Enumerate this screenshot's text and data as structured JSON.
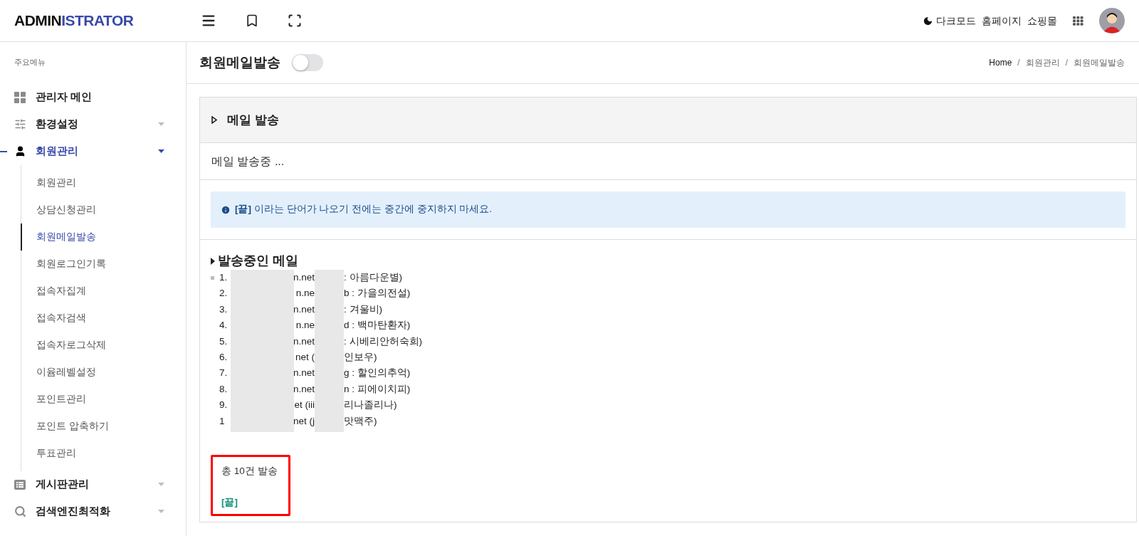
{
  "header": {
    "logo": {
      "part_1": "ADMIN",
      "part_2": "ISTRATOR"
    },
    "links": [
      {
        "kind": "darkmode",
        "label": "다크모드"
      },
      {
        "kind": "link",
        "label": "홈페이지"
      },
      {
        "kind": "link",
        "label": "쇼핑몰"
      }
    ]
  },
  "sidebar": {
    "section_title": "주요메뉴",
    "items": [
      {
        "label": "관리자 메인",
        "expandable": false,
        "expanded": false
      },
      {
        "label": "환경설정",
        "expandable": true,
        "expanded": false
      },
      {
        "label": "회원관리",
        "expandable": true,
        "expanded": true,
        "children": [
          {
            "label": "회원관리",
            "selected": false
          },
          {
            "label": "상담신청관리",
            "selected": false
          },
          {
            "label": "회원메일발송",
            "selected": true
          },
          {
            "label": "회원로그인기록",
            "selected": false
          },
          {
            "label": "접속자집계",
            "selected": false
          },
          {
            "label": "접속자검색",
            "selected": false
          },
          {
            "label": "접속자로그삭제",
            "selected": false
          },
          {
            "label": "이윰레벨설정",
            "selected": false
          },
          {
            "label": "포인트관리",
            "selected": false
          },
          {
            "label": "포인트 압축하기",
            "selected": false
          },
          {
            "label": "투표관리",
            "selected": false
          }
        ]
      },
      {
        "label": "게시판관리",
        "expandable": true,
        "expanded": false
      },
      {
        "label": "검색엔진최적화",
        "expandable": true,
        "expanded": false
      }
    ]
  },
  "page": {
    "title": "회원메일발송",
    "toggle": {
      "on": false
    },
    "breadcrumb": {
      "items": [
        "Home",
        "회원관리",
        "회원메일발송"
      ],
      "separators": [
        "/",
        "/"
      ]
    }
  },
  "card": {
    "title": "메일 발송",
    "status": "메일 발송중 ...",
    "alert": "**[끝]** 이라는 단어가 나오기 전에는 중간에 중지하지 마세요.",
    "list_title": "발송중인 메일",
    "rows": [
      {
        "number": "1.",
        "middle": "n.net",
        "end": ": 아름다운별)"
      },
      {
        "number": "2.",
        "middle": "n.ne",
        "end": "b : 가을의전설)"
      },
      {
        "number": "3.",
        "middle": "n.net",
        "end": ": 겨울비)"
      },
      {
        "number": "4.",
        "middle": "n.ne",
        "end": "d : 백마탄환자)"
      },
      {
        "number": "5.",
        "middle": "n.net",
        "end": ": 시베리안허숙희)"
      },
      {
        "number": "6.",
        "middle": "net (",
        "end": "인보우)"
      },
      {
        "number": "7.",
        "middle": "n.net",
        "end": "g : 할인의추억)"
      },
      {
        "number": "8.",
        "middle": "n.net",
        "end": "n : 피에이치피)"
      },
      {
        "number": "9.",
        "middle": "et (iii",
        "end": "리나졸리나)"
      },
      {
        "number": "1",
        "middle": "net (j",
        "end": "맛맥주)"
      }
    ],
    "total": "총 10건 발송",
    "end_mark": "[끝]"
  }
}
